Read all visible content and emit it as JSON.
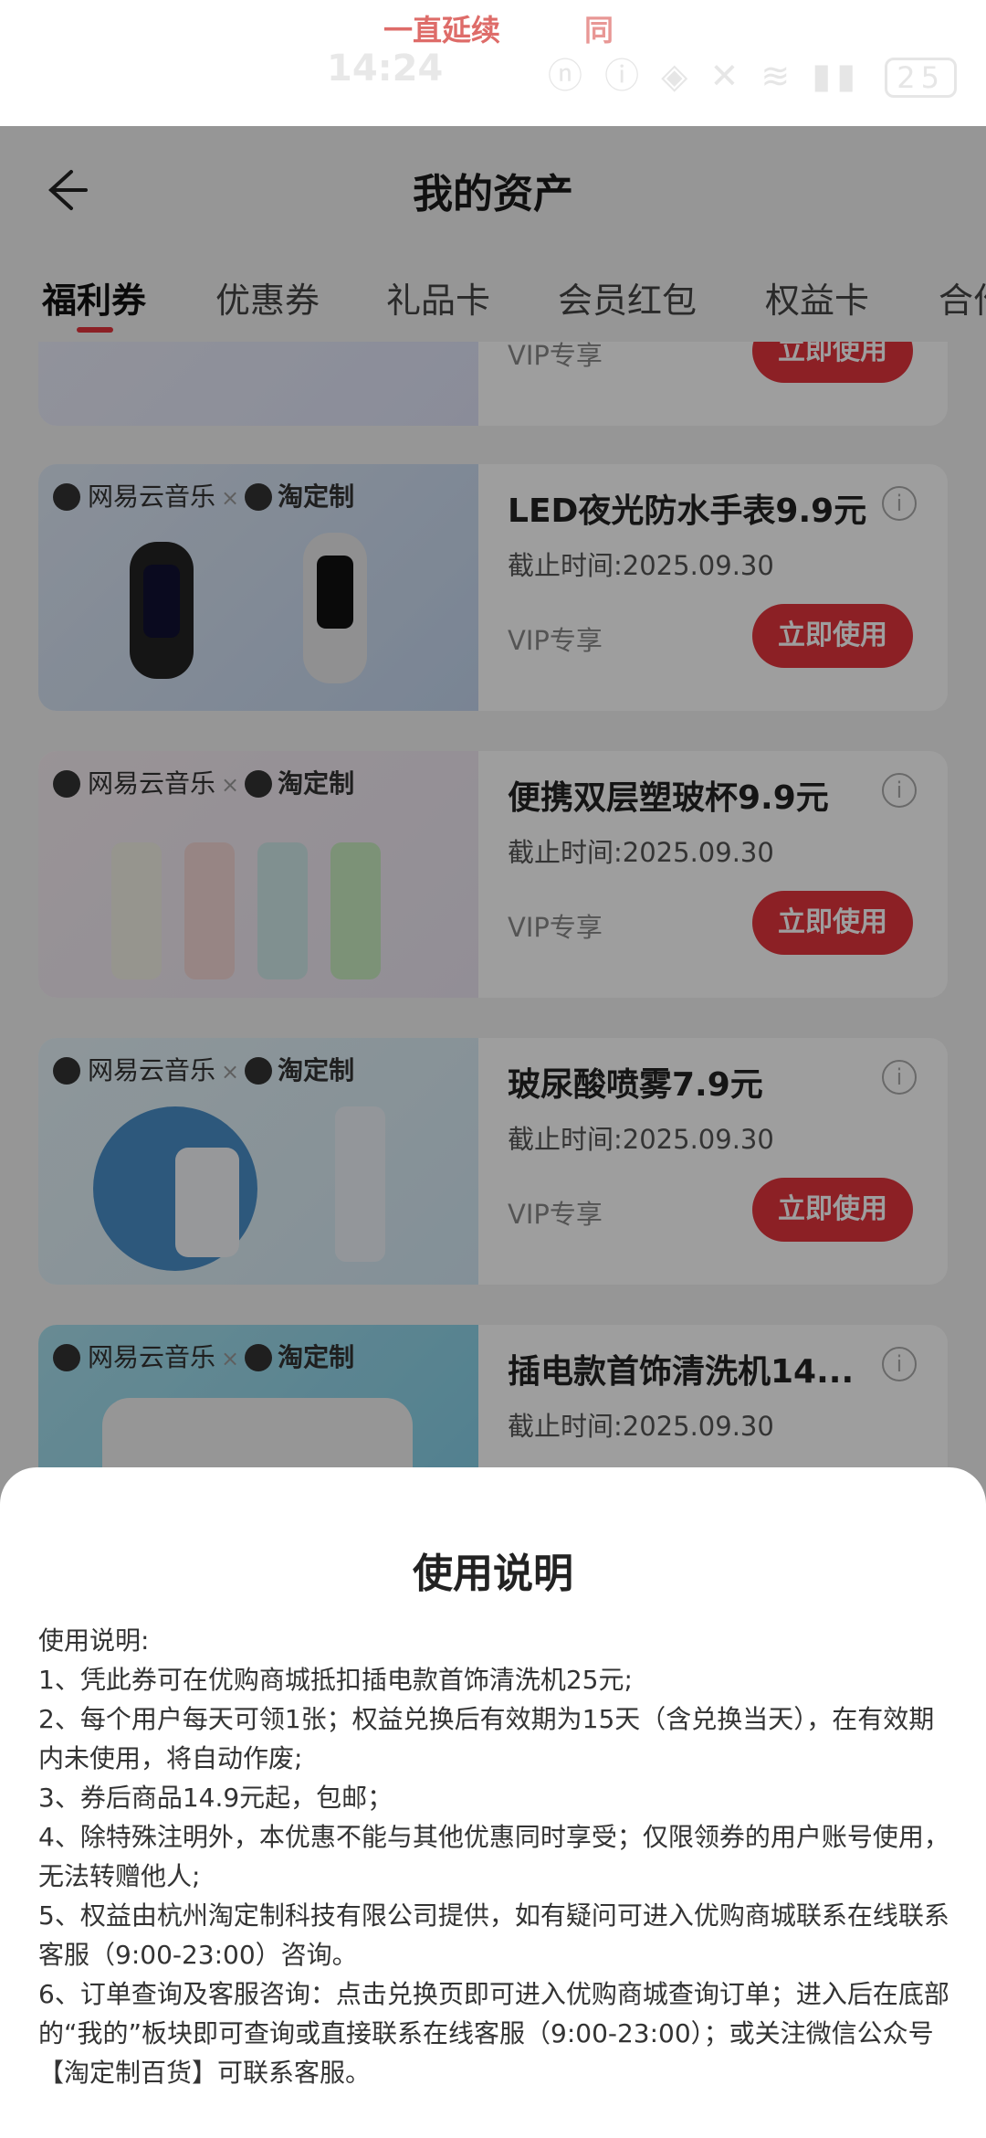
{
  "status_bar": {
    "marquee_left": "一直延续",
    "marquee_right": "同",
    "time": "14:24",
    "icons": "ⓝ ⓘ ◈ ✕ ≋ ▮▮",
    "battery": "25"
  },
  "header": {
    "title": "我的资产"
  },
  "tabs": [
    {
      "label": "福利券"
    },
    {
      "label": "优惠券"
    },
    {
      "label": "礼品卡"
    },
    {
      "label": "会员红包"
    },
    {
      "label": "权益卡"
    },
    {
      "label": "合作"
    }
  ],
  "coupon_common": {
    "brand_left": "网易云音乐",
    "brand_x": "×",
    "brand_right": "淘定制",
    "vip_label": "VIP专享",
    "button_label": "立即使用",
    "info_icon": "i"
  },
  "coupons": [
    {
      "name": "",
      "deadline": ""
    },
    {
      "name": "LED夜光防水手表9.9元",
      "deadline": "截止时间:2025.09.30"
    },
    {
      "name": "便携双层塑玻杯9.9元",
      "deadline": "截止时间:2025.09.30"
    },
    {
      "name": "玻尿酸喷雾7.9元",
      "deadline": "截止时间:2025.09.30"
    },
    {
      "name": "插电款首饰清洗机14...",
      "deadline": "截止时间:2025.09.30"
    }
  ],
  "sheet": {
    "title": "使用说明",
    "lines": [
      "使用说明:",
      "1、凭此券可在优购商城抵扣插电款首饰清洗机25元;",
      "2、每个用户每天可领1张；权益兑换后有效期为15天（含兑换当天），在有效期内未使用，将自动作废;",
      "3、券后商品14.9元起，包邮；",
      "4、除特殊注明外，本优惠不能与其他优惠同时享受；仅限领券的用户账号使用，无法转赠他人;",
      "5、权益由杭州淘定制科技有限公司提供，如有疑问可进入优购商城联系在线联系客服（9:00-23:00）咨询。",
      "6、订单查询及客服咨询：点击兑换页即可进入优购商城查询订单；进入后在底部的“我的”板块即可查询或直接联系在线客服（9:00-23:00）；或关注微信公众号【淘定制百货】可联系客服。"
    ]
  },
  "colors": {
    "accent": "#e3343c",
    "overlay": "rgba(0,0,0,0.38)"
  }
}
